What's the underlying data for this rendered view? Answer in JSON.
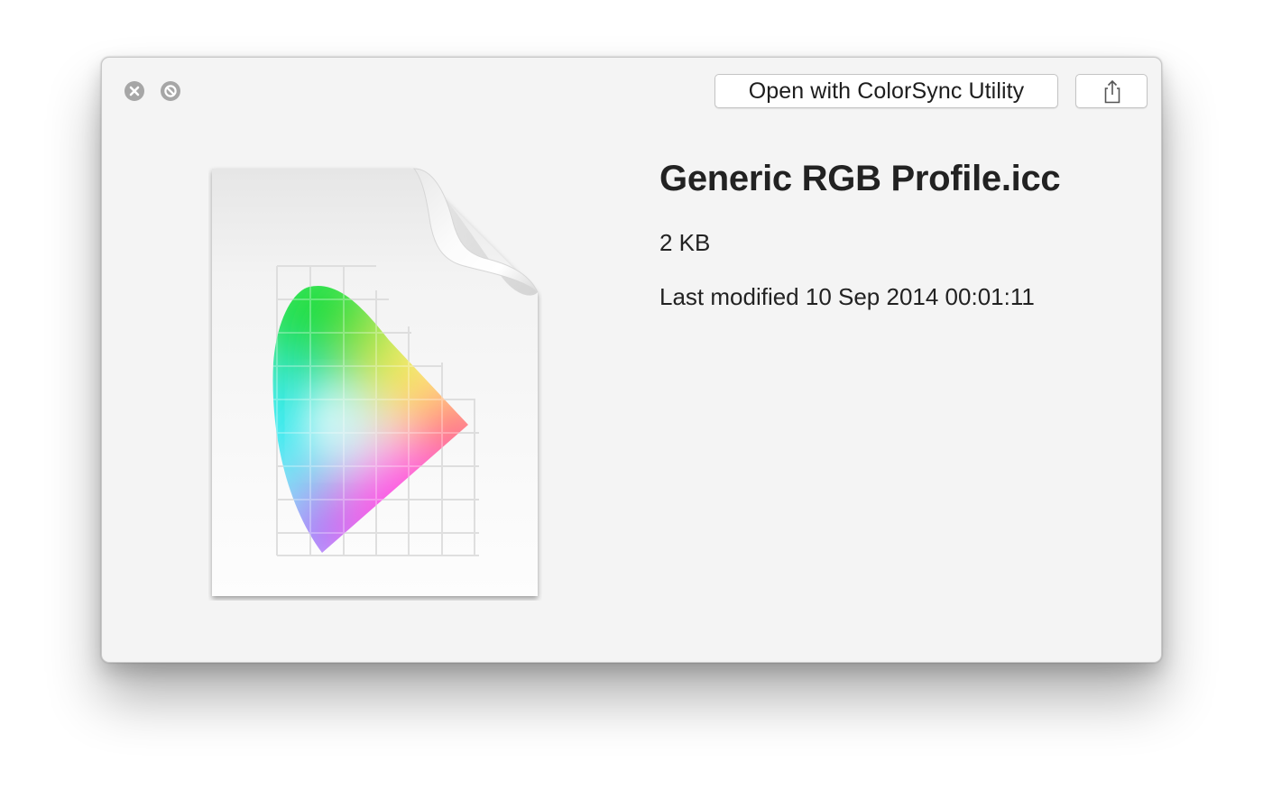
{
  "window": {
    "background": "#f4f4f4"
  },
  "titlebar": {
    "close_icon": "close-icon",
    "fullscreen_icon": "fullscreen-disabled-icon",
    "open_with_label": "Open with ColorSync Utility",
    "share_icon": "share-icon"
  },
  "file": {
    "icon": "colorsync-profile-document-icon",
    "name": "Generic RGB Profile.icc",
    "size": "2 KB",
    "modified": "Last modified 10 Sep 2014 00:01:11"
  },
  "colors": {
    "text": "#222222",
    "button_border": "#c4c4c4",
    "window_control": "#a6a6a6"
  }
}
